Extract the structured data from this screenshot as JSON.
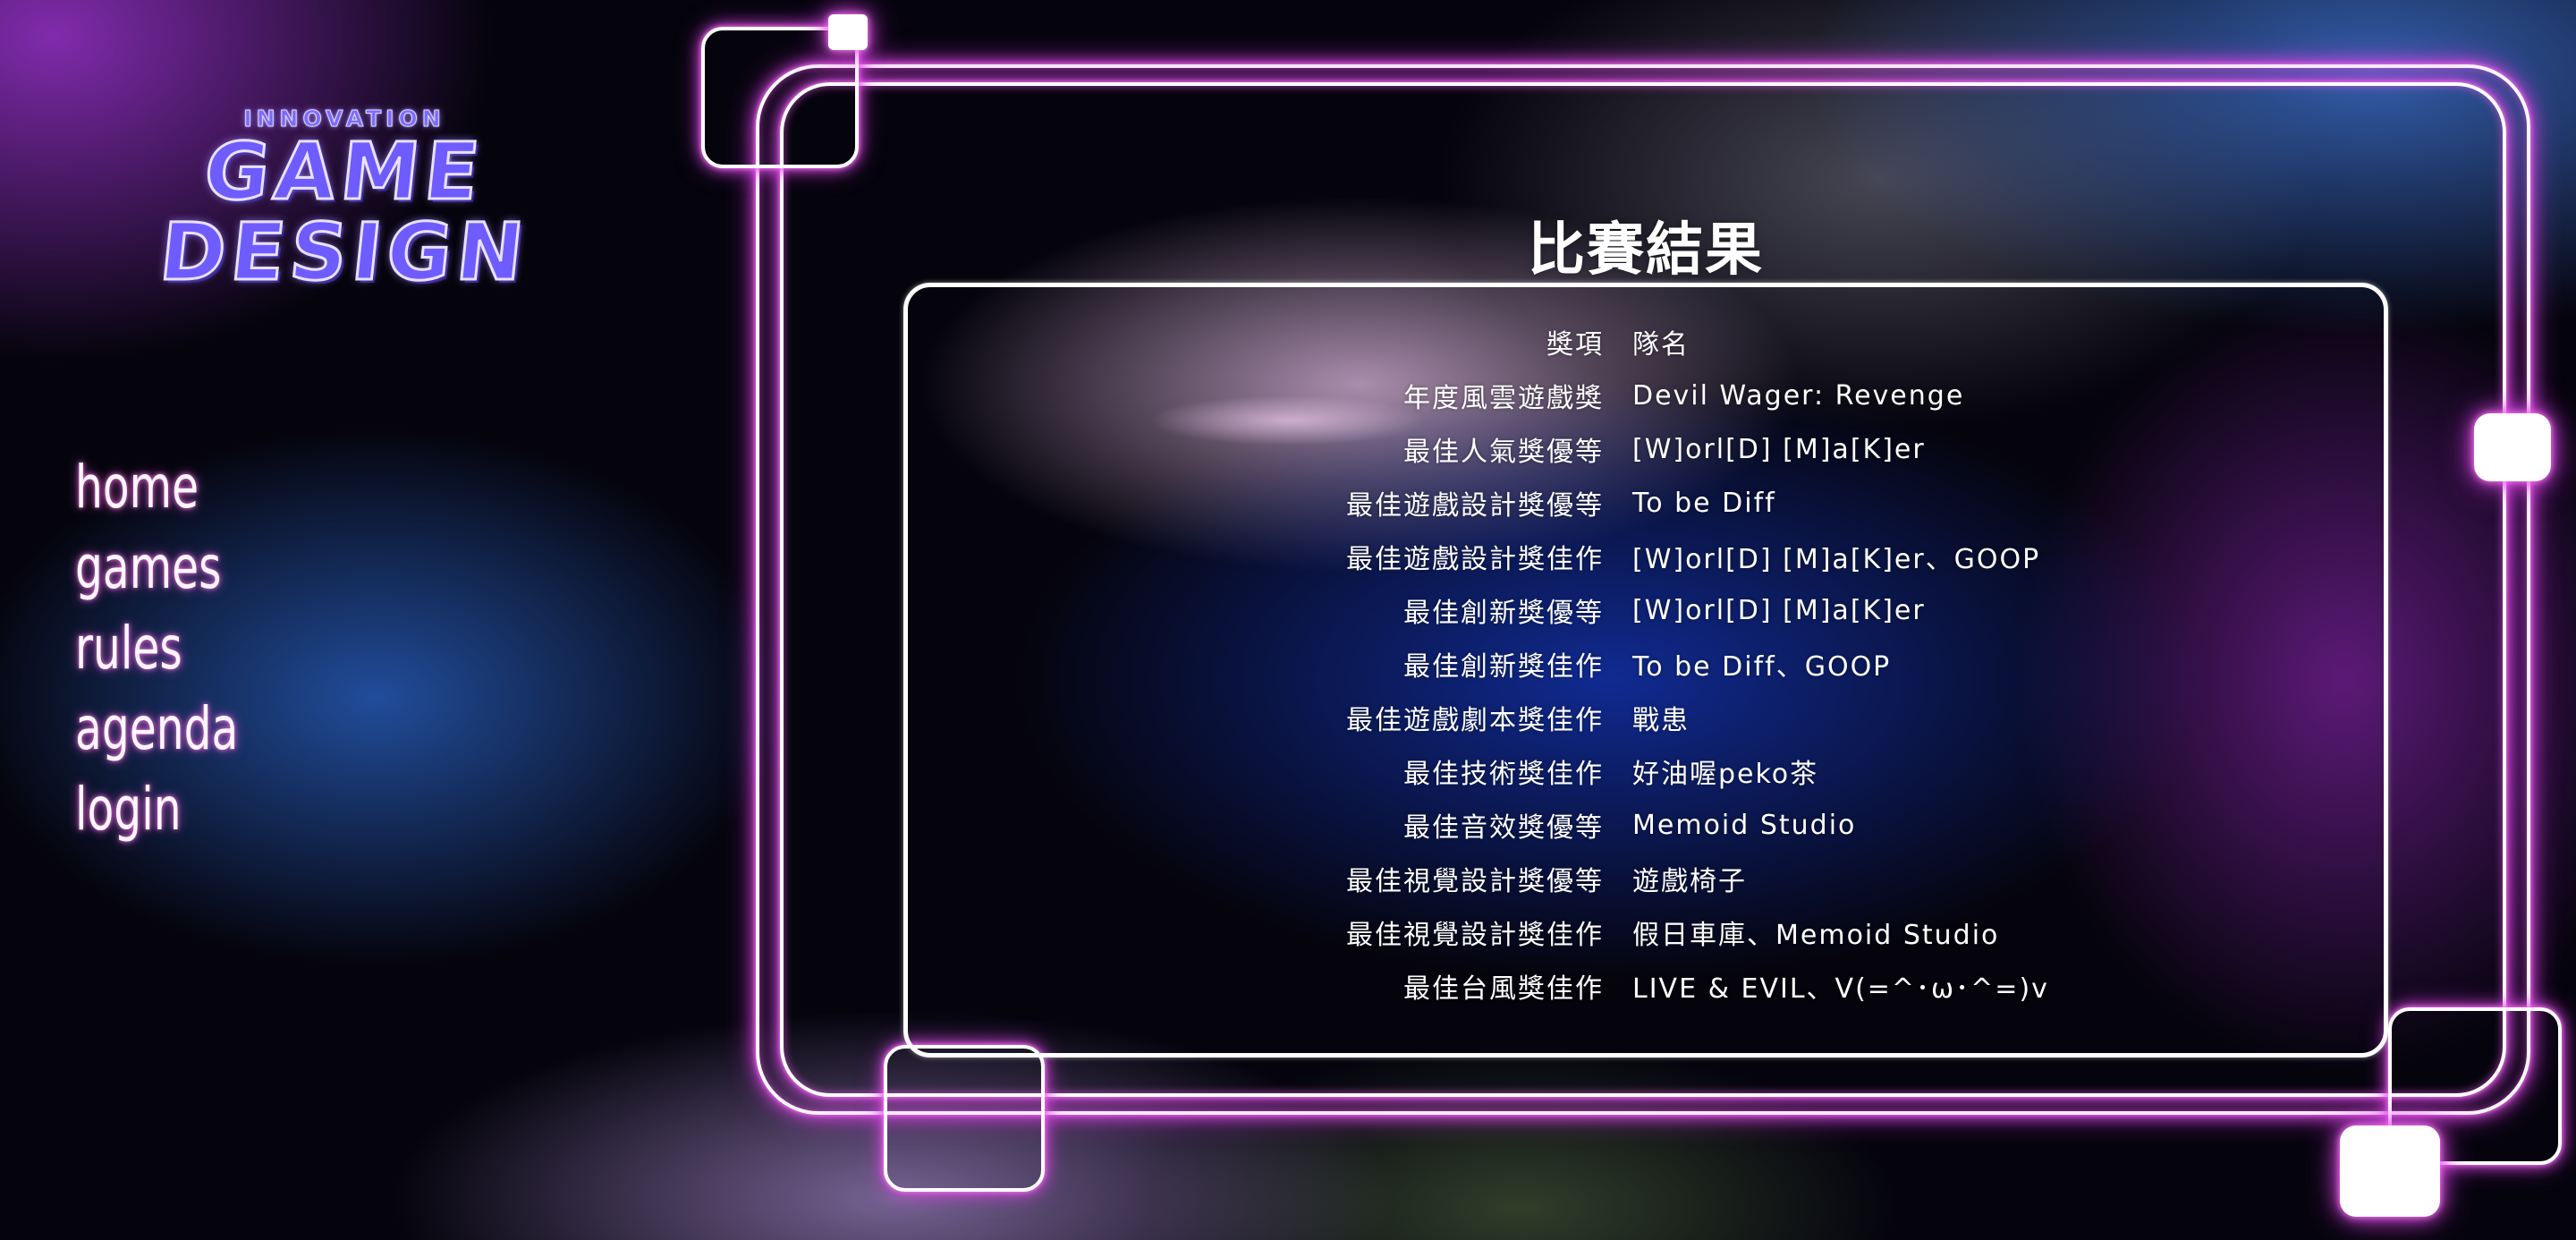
{
  "logo": {
    "small": "INNOVATION",
    "line1": "GAME",
    "line2": "DESIGN"
  },
  "nav": {
    "items": [
      {
        "label": "home"
      },
      {
        "label": "games"
      },
      {
        "label": "rules"
      },
      {
        "label": "agenda"
      },
      {
        "label": "login"
      }
    ]
  },
  "results": {
    "title": "比賽結果",
    "header": {
      "award": "獎項",
      "team": "隊名"
    },
    "rows": [
      {
        "award": "年度風雲遊戲獎",
        "team": "Devil Wager: Revenge"
      },
      {
        "award": "最佳人氣獎優等",
        "team": "[W]orl[D] [M]a[K]er"
      },
      {
        "award": "最佳遊戲設計獎優等",
        "team": "To be Diff"
      },
      {
        "award": "最佳遊戲設計獎佳作",
        "team": "[W]orl[D] [M]a[K]er、GOOP"
      },
      {
        "award": "最佳創新獎優等",
        "team": "[W]orl[D] [M]a[K]er"
      },
      {
        "award": "最佳創新獎佳作",
        "team": "To be Diff、GOOP"
      },
      {
        "award": "最佳遊戲劇本獎佳作",
        "team": "戰患"
      },
      {
        "award": "最佳技術獎佳作",
        "team": "好油喔peko茶"
      },
      {
        "award": "最佳音效獎優等",
        "team": "Memoid Studio"
      },
      {
        "award": "最佳視覺設計獎優等",
        "team": "遊戲椅子"
      },
      {
        "award": "最佳視覺設計獎佳作",
        "team": "假日車庫、Memoid Studio"
      },
      {
        "award": "最佳台風獎佳作",
        "team": "LIVE & EVIL、V(=^･ω･^=)v"
      }
    ]
  },
  "colors": {
    "neon_glow": "#e14ee6",
    "neon_core": "#ffffff",
    "background": "#05040d",
    "logo_fill": "#6f5cff"
  }
}
